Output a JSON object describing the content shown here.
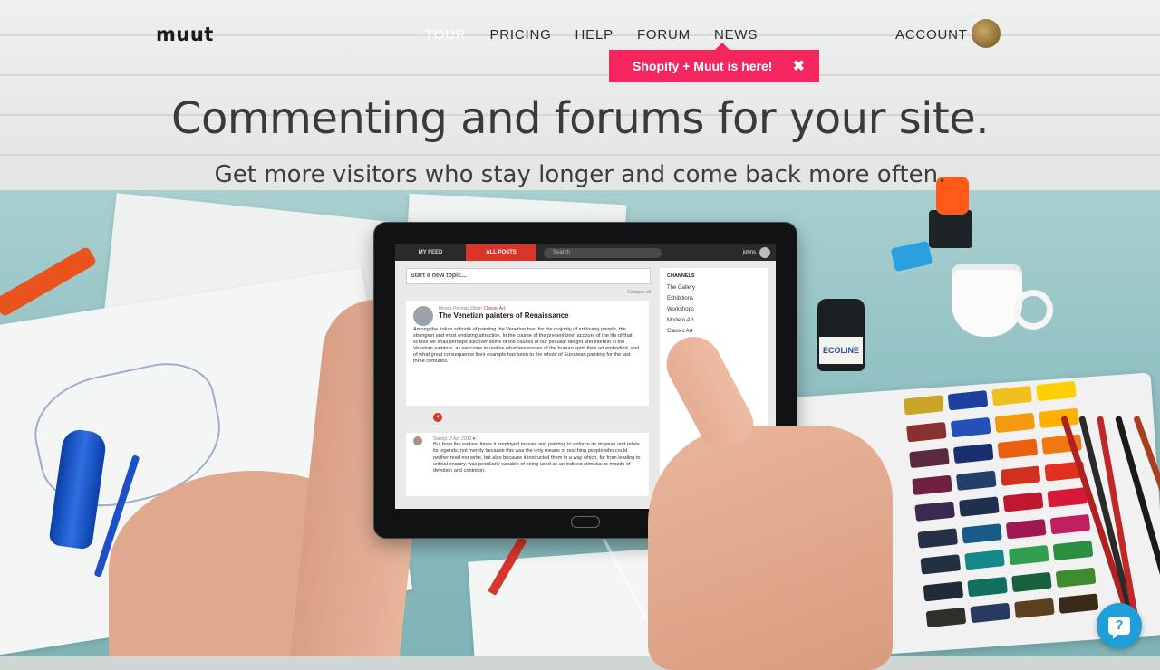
{
  "nav": {
    "logo": "muut",
    "links": [
      "TOUR",
      "PRICING",
      "HELP",
      "FORUM",
      "NEWS"
    ],
    "account": "ACCOUNT"
  },
  "promo": {
    "text": "Shopify + Muut is here!",
    "close": "✖"
  },
  "hero": {
    "headline": "Commenting and forums for your site.",
    "subhead": "Get more visitors who stay longer and come back more often."
  },
  "tablet": {
    "tabs": [
      "MY FEED",
      "ALL POSTS"
    ],
    "search_placeholder": "Search",
    "user": "johns",
    "new_topic": "Start a new topic...",
    "collapse": "Collapse all",
    "post": {
      "meta_author": "Moses Pinman 18d in",
      "meta_channel": "Classic Art",
      "title": "The Venetian painters of Renaissance",
      "body": "Among the Italian schools of painting the Venetian has, for the majority of art-loving people, the strongest and most enduring attraction. In the course of the present brief account of the life of that school we shall perhaps discover some of the causes of our peculiar delight and interest in the Venetian painters, as we come to realise what tendencies of the human spirit their art embodied, and of what great consequence their example has been to the whole of European painting for the last three centuries.",
      "replies_count": "4"
    },
    "reply": {
      "meta": "Sandyl, 2 Apr 2013",
      "likes": "1",
      "body": "But from the earliest times it employed mosaic and painting to enforce its dogmas and relate its legends, not merely because this was the only means of reaching people who could neither read nor write, but also because it instructed them in a way which, far from leading to critical enquiry, was peculiarly capable of being used as an indirect stimulus to moods of devotion and contrition."
    },
    "channels": {
      "heading": "CHANNELS",
      "items": [
        "The Gallery",
        "Exhibitions",
        "Workshops",
        "Modern Art",
        "Classic Art"
      ]
    },
    "ink_label": "ECOLINE"
  },
  "help": {
    "icon": "?"
  },
  "colors": {
    "promo": "#f5255e",
    "help": "#1f9ed9",
    "all_posts_tab": "#d8362a"
  }
}
